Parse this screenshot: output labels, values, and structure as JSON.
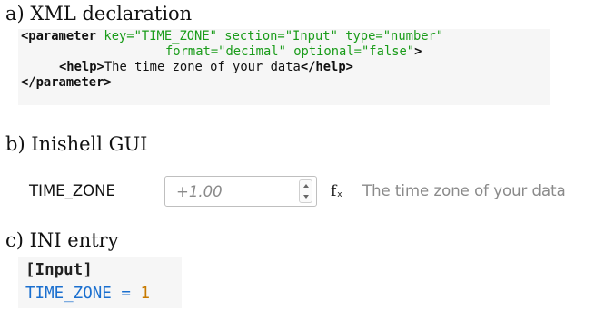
{
  "headings": {
    "a": "a) XML declaration",
    "b": "b) Inishell GUI",
    "c": "c) INI entry"
  },
  "xml": {
    "line1": {
      "tag_open": "<parameter",
      "attrs": " key=\"TIME_ZONE\" section=\"Input\" type=\"number\""
    },
    "line2": {
      "attrs": "format=\"decimal\" optional=\"false\"",
      "close": ">"
    },
    "line3": {
      "help_open": "<help>",
      "text": "The time zone of your data",
      "help_close": "</help>"
    },
    "line4": {
      "tag_close": "</parameter>"
    }
  },
  "gui": {
    "label": "TIME_ZONE",
    "spin_value": "+1.00",
    "fx_symbol": "f",
    "fx_sub": "x",
    "help_text": "The time zone of your data"
  },
  "ini": {
    "section": "[Input]",
    "key": "TIME_ZONE",
    "eq": " = ",
    "value": "1"
  },
  "colors": {
    "xml_attr": "#1a9c1a",
    "ini_key": "#1a6fcf",
    "ini_value": "#c87a00",
    "code_bg": "#f6f6f6",
    "muted_text": "#8a8a8a"
  }
}
